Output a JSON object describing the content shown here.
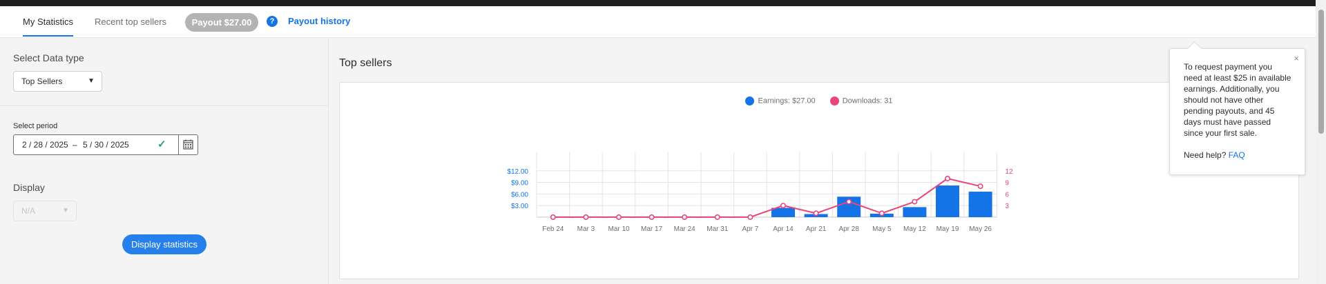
{
  "tabs": [
    {
      "label": "My Statistics",
      "active": true
    },
    {
      "label": "Recent top sellers",
      "active": false
    }
  ],
  "payout": {
    "pill_label": "Payout $27.00",
    "help_glyph": "?",
    "history_label": "Payout history"
  },
  "left": {
    "data_type_label": "Select Data type",
    "data_type_value": "Top Sellers",
    "period_label": "Select period",
    "start_date": "2 / 28 / 2025",
    "date_separator": "–",
    "end_date": "5 / 30 / 2025",
    "display_label": "Display",
    "display_value": "N/A",
    "display_button": "Display statistics"
  },
  "panel": {
    "title": "Top sellers"
  },
  "tooltip": {
    "text": "To request payment you need at least $25 in available earnings. Additionally, you should not have other pending payouts, and 45 days must have passed since your first sale.",
    "help_prefix": "Need help?",
    "faq_label": "FAQ",
    "close_glyph": "×"
  },
  "colors": {
    "earnings": "#1473e6",
    "downloads": "#e8457c",
    "accent": "#1473e6",
    "success": "#2d9d78"
  },
  "chart_data": {
    "type": "bar",
    "categories": [
      "Feb 24",
      "Mar 3",
      "Mar 10",
      "Mar 17",
      "Mar 24",
      "Mar 31",
      "Apr 7",
      "Apr 14",
      "Apr 21",
      "Apr 28",
      "May 5",
      "May 12",
      "May 19",
      "May 26"
    ],
    "series": [
      {
        "name": "Earnings: $27.00",
        "type": "bar",
        "axis": "left",
        "values": [
          0,
          0,
          0,
          0,
          0,
          0,
          0,
          2.4,
          0.8,
          5.3,
          0.9,
          2.6,
          8.2,
          6.6
        ]
      },
      {
        "name": "Downloads: 31",
        "type": "line",
        "axis": "right",
        "values": [
          0,
          0,
          0,
          0,
          0,
          0,
          0,
          3,
          1,
          4,
          1,
          4,
          10,
          8
        ]
      }
    ],
    "left_ticks": [
      "$3.00",
      "$6.00",
      "$9.00",
      "$12.00"
    ],
    "left_tick_values": [
      3,
      6,
      9,
      12
    ],
    "right_ticks": [
      "3",
      "6",
      "9",
      "12"
    ],
    "right_tick_values": [
      3,
      6,
      9,
      12
    ],
    "ylim_left": [
      0,
      15
    ],
    "ylim_right": [
      0,
      15
    ],
    "grid": true,
    "legend": "top-center"
  }
}
